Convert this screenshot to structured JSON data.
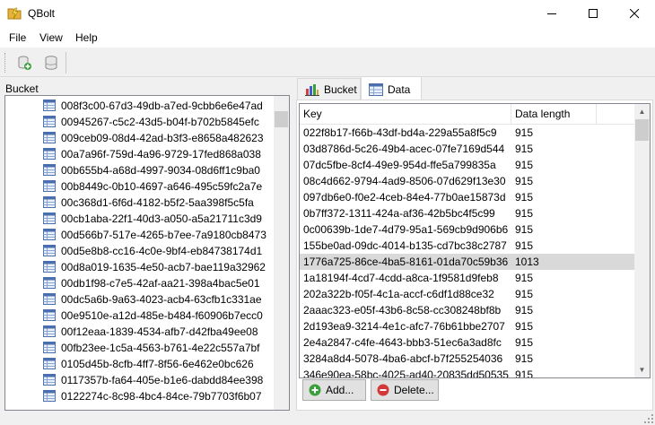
{
  "window": {
    "title": "QBolt"
  },
  "menu": [
    {
      "label": "File"
    },
    {
      "label": "View"
    },
    {
      "label": "Help"
    }
  ],
  "left": {
    "label": "Bucket",
    "items": [
      "008f3c00-67d3-49db-a7ed-9cbb6e6e47ad",
      "00945267-c5c2-43d5-b04f-b702b5845efc",
      "009ceb09-08d4-42ad-b3f3-e8658a482623",
      "00a7a96f-759d-4a96-9729-17fed868a038",
      "00b655b4-a68d-4997-9034-08d6ff1c9ba0",
      "00b8449c-0b10-4697-a646-495c59fc2a7e",
      "00c368d1-6f6d-4182-b5f2-5aa398f5c5fa",
      "00cb1aba-22f1-40d3-a050-a5a21711c3d9",
      "00d566b7-517e-4265-b7ee-7a9180cb8473",
      "00d5e8b8-cc16-4c0e-9bf4-eb84738174d1",
      "00d8a019-1635-4e50-acb7-bae119a32962",
      "00db1f98-c7e5-42af-aa21-398a4bac5e01",
      "00dc5a6b-9a63-4023-acb4-63cfb1c331ae",
      "00e9510e-a12d-485e-b484-f60906b7ecc0",
      "00f12eaa-1839-4534-afb7-d42fba49ee08",
      "00fb23ee-1c5a-4563-b761-4e22c557a7bf",
      "0105d45b-8cfb-4ff7-8f56-6e462e0bc626",
      "0117357b-fa64-405e-b1e6-dabdd84ee398",
      "0122274c-8c98-4bc4-84ce-79b7703f6b07"
    ]
  },
  "tabs": [
    {
      "label": "Bucket"
    },
    {
      "label": "Data"
    }
  ],
  "table": {
    "columns": [
      "Key",
      "Data length"
    ],
    "rows": [
      [
        "022f8b17-f66b-43df-bd4a-229a55a8f5c9",
        "915"
      ],
      [
        "03d8786d-5c26-49b4-acec-07fe7169d544",
        "915"
      ],
      [
        "07dc5fbe-8cf4-49e9-954d-ffe5a799835a",
        "915"
      ],
      [
        "08c4d662-9794-4ad9-8506-07d629f13e30",
        "915"
      ],
      [
        "097db6e0-f0e2-4ceb-84e4-77b0ae15873d",
        "915"
      ],
      [
        "0b7ff372-1311-424a-af36-42b5bc4f5c99",
        "915"
      ],
      [
        "0c00639b-1de7-4d79-95a1-569cb9d906b6",
        "915"
      ],
      [
        "155be0ad-09dc-4014-b135-cd7bc38c2787",
        "915"
      ],
      [
        "1776a725-86ce-4ba5-8161-01da70c59b36",
        "1013"
      ],
      [
        "1a18194f-4cd7-4cdd-a8ca-1f9581d9feb8",
        "915"
      ],
      [
        "202a322b-f05f-4c1a-accf-c6df1d88ce32",
        "915"
      ],
      [
        "2aaac323-e05f-43b6-8c58-cc308248bf8b",
        "915"
      ],
      [
        "2d193ea9-3214-4e1c-afc7-76b61bbe2707",
        "915"
      ],
      [
        "2e4a2847-c4fe-4643-bbb3-51ec6a3ad8fc",
        "915"
      ],
      [
        "3284a8d4-5078-4ba6-abcf-b7f255254036",
        "915"
      ],
      [
        "346e90ea-58bc-4025-ad40-20835dd50535",
        "915"
      ]
    ],
    "selected_index": 8
  },
  "buttons": {
    "add": "Add...",
    "delete": "Delete..."
  },
  "colors": {
    "selection": "#d9d9d9",
    "add_icon": "#3a9e3a",
    "delete_icon": "#d23a3a"
  }
}
